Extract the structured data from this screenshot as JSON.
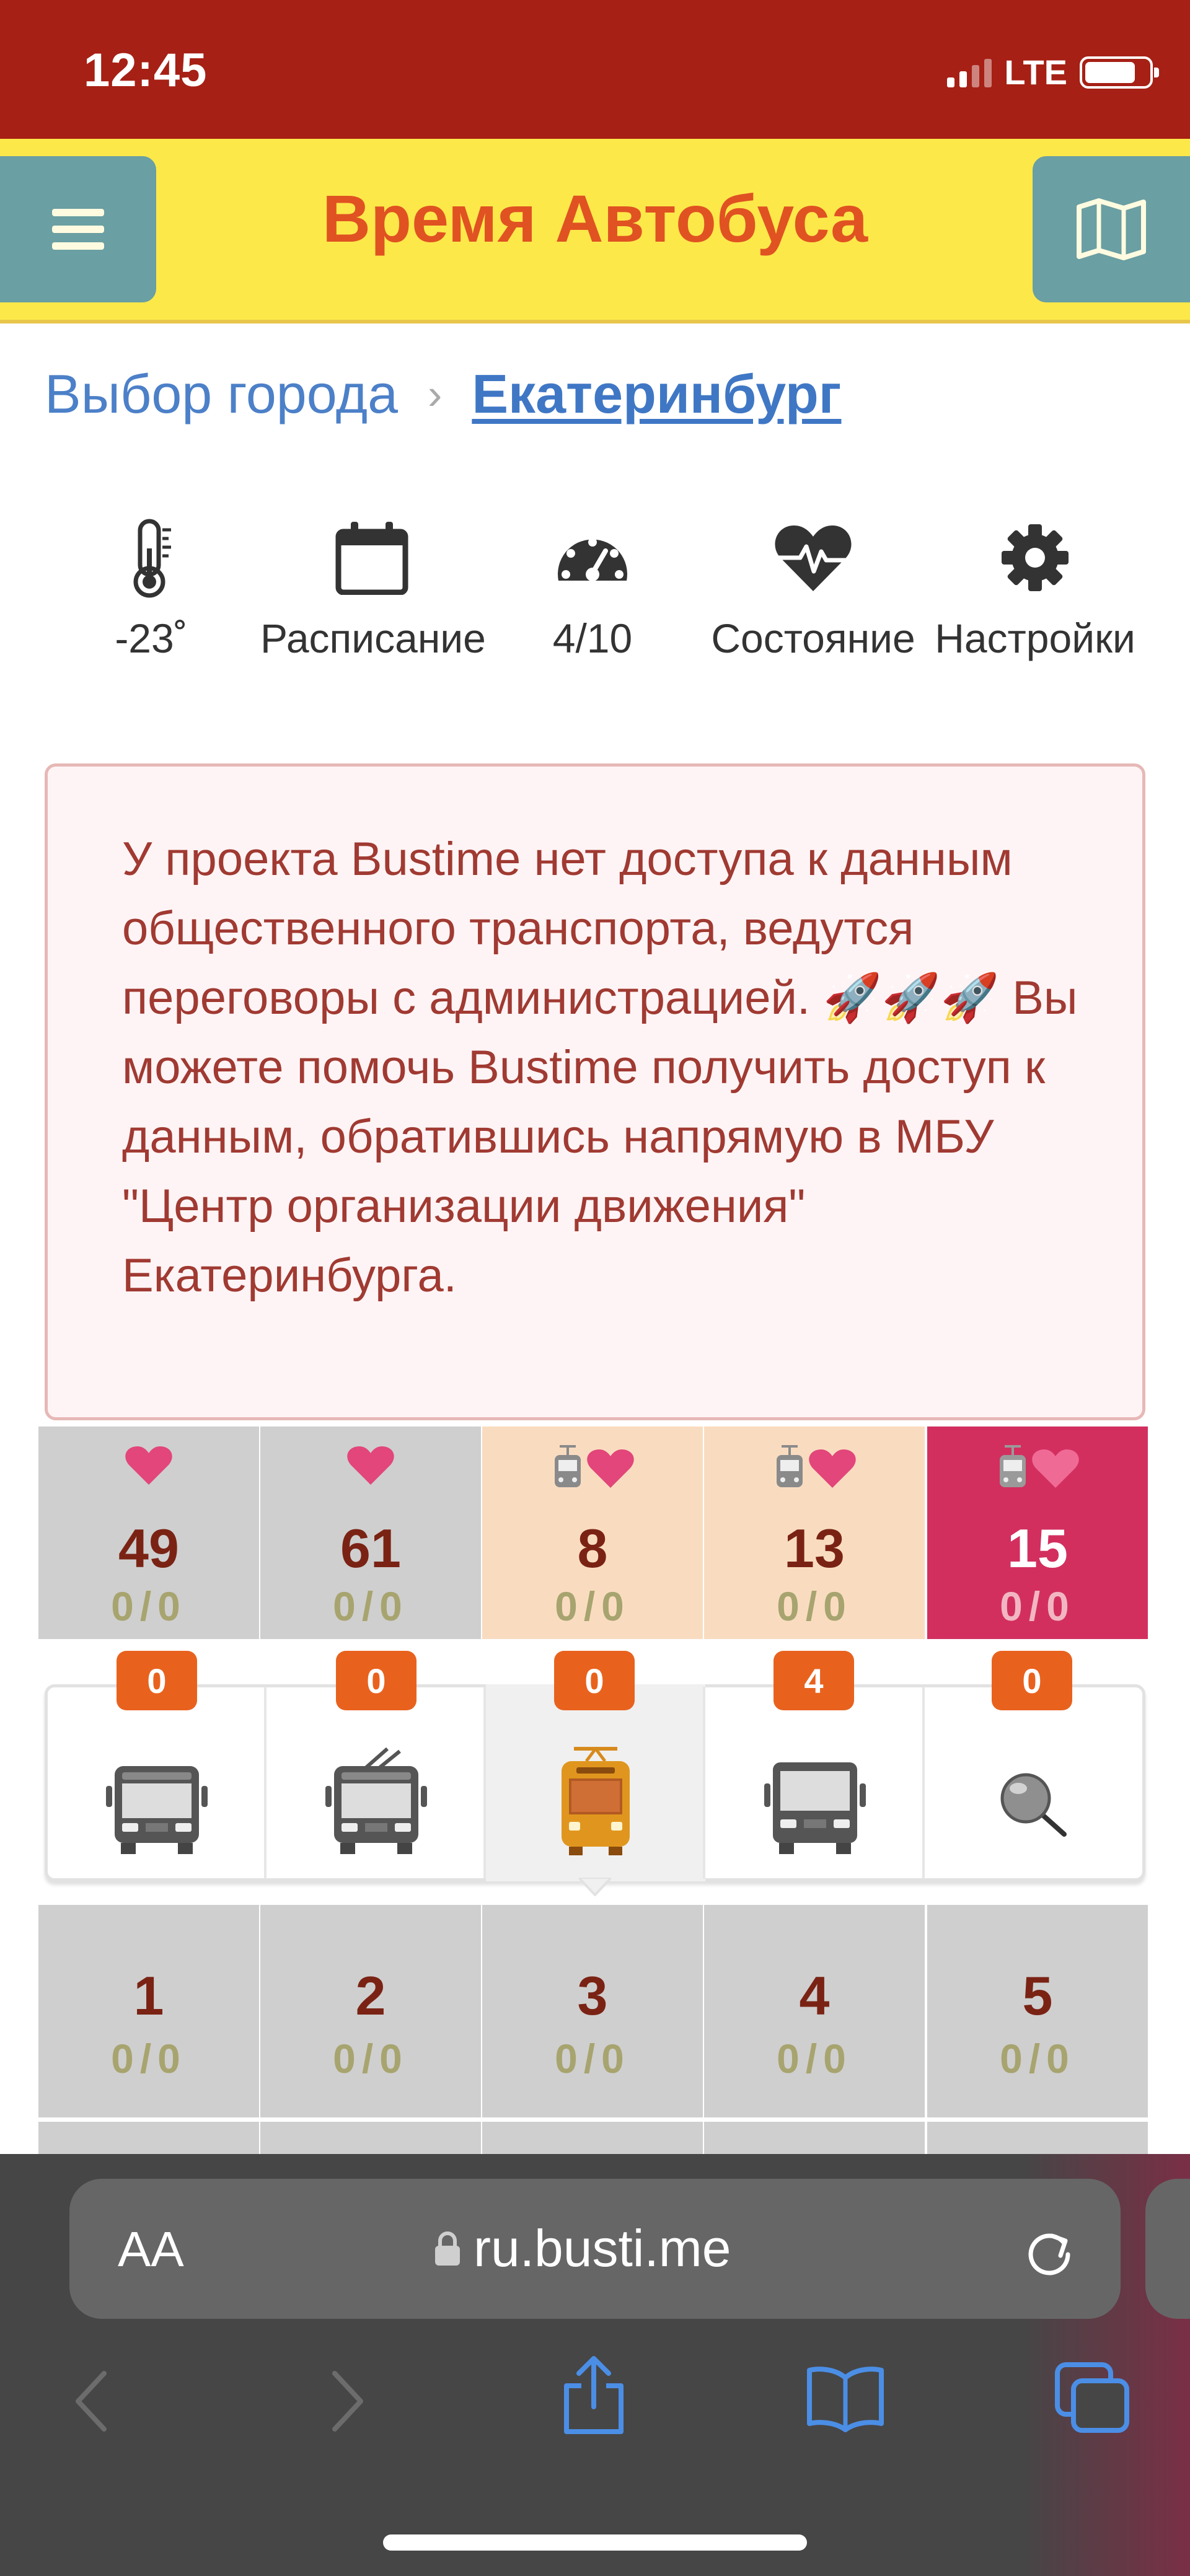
{
  "status_bar": {
    "time": "12:45",
    "network": "LTE"
  },
  "header": {
    "title": "Время Автобуса"
  },
  "breadcrumb": {
    "city_select": "Выбор города",
    "separator": "›",
    "current": "Екатеринбург"
  },
  "tools": [
    {
      "icon": "thermometer-icon",
      "label": "-23˚"
    },
    {
      "icon": "calendar-icon",
      "label": "Расписание"
    },
    {
      "icon": "speedometer-icon",
      "label": "4/10"
    },
    {
      "icon": "heart-pulse-icon",
      "label": "Состояние"
    },
    {
      "icon": "gear-icon",
      "label": "Настройки"
    }
  ],
  "alert": {
    "text_before": "У проекта Bustime нет доступа к данным общественного транспорта, ведутся переговоры с администрацией.",
    "emoji": "🚀🚀🚀",
    "text_after": "Вы можете помочь Bustime получить доступ к данным, обратившись напрямую в МБУ \"Центр организации движения\" Екатеринбурга."
  },
  "favorite_routes": [
    {
      "number": "49",
      "count": "0/0",
      "type": "bus",
      "style": "gray"
    },
    {
      "number": "61",
      "count": "0/0",
      "type": "bus",
      "style": "gray"
    },
    {
      "number": "8",
      "count": "0/0",
      "type": "tram",
      "style": "peach"
    },
    {
      "number": "13",
      "count": "0/0",
      "type": "tram",
      "style": "peach"
    },
    {
      "number": "15",
      "count": "0/0",
      "type": "tram",
      "style": "red"
    }
  ],
  "transport_tabs": [
    {
      "name": "bus",
      "badge": "0"
    },
    {
      "name": "trolleybus",
      "badge": "0"
    },
    {
      "name": "tram",
      "badge": "0",
      "active": true
    },
    {
      "name": "intercity-bus",
      "badge": "4"
    },
    {
      "name": "search",
      "badge": "0"
    }
  ],
  "routes": [
    {
      "number": "1",
      "count": "0/0"
    },
    {
      "number": "2",
      "count": "0/0"
    },
    {
      "number": "3",
      "count": "0/0"
    },
    {
      "number": "4",
      "count": "0/0"
    },
    {
      "number": "5",
      "count": "0/0"
    }
  ],
  "browser": {
    "text_size_label": "AA",
    "url": "ru.busti.me"
  },
  "colors": {
    "status_bar": "#a62015",
    "header_bg": "#fde84a",
    "title": "#e05222",
    "badge": "#e8621e",
    "route_number": "#7a2314",
    "favorite_heart": "#e2467a",
    "active_route": "#d22f5f"
  }
}
